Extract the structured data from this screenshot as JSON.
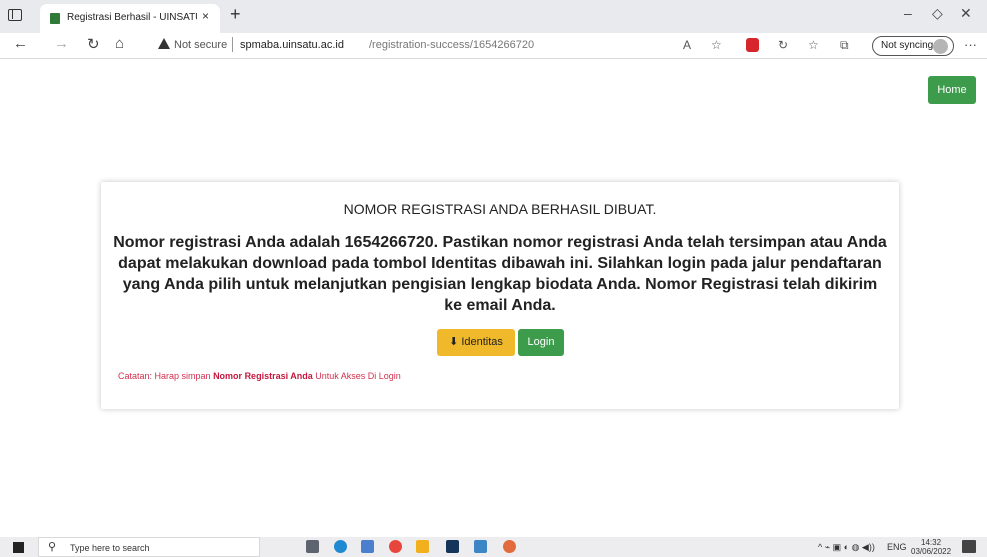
{
  "browser": {
    "tab_title": "Registrasi Berhasil - UINSATU Sm",
    "tab_close": "×",
    "new_tab": "+",
    "url_warning": "Not secure",
    "url_host": "spmaba.uinsatu.ac.id",
    "url_path": "/registration-success/1654266720",
    "sync_label": "Not syncing",
    "more": "···",
    "win_minimize": "–",
    "win_restore": "◇",
    "win_close": "✕"
  },
  "page": {
    "home_label": "Home",
    "heading": "NOMOR REGISTRASI ANDA BERHASIL DIBUAT.",
    "message": "Nomor registrasi Anda adalah 1654266720. Pastikan nomor registrasi Anda telah tersimpan atau Anda dapat melakukan download pada tombol Identitas dibawah ini. Silahkan login pada jalur pendaftaran yang Anda pilih untuk melanjutkan pengisian lengkap biodata Anda. Nomor Registrasi telah dikirim ke email Anda.",
    "identitas_label": "Identitas",
    "login_label": "Login",
    "note_prefix": "Catatan: Harap simpan ",
    "note_bold": "Nomor Registrasi Anda",
    "note_suffix": " Untuk Akses Di Login"
  },
  "taskbar": {
    "search_placeholder": "Type here to search",
    "language": "ENG",
    "time": "14:32",
    "date": "03/06/2022"
  },
  "colors": {
    "green": "#3d9b4c",
    "yellow": "#f0b92b",
    "note_red": "#d0314f"
  }
}
